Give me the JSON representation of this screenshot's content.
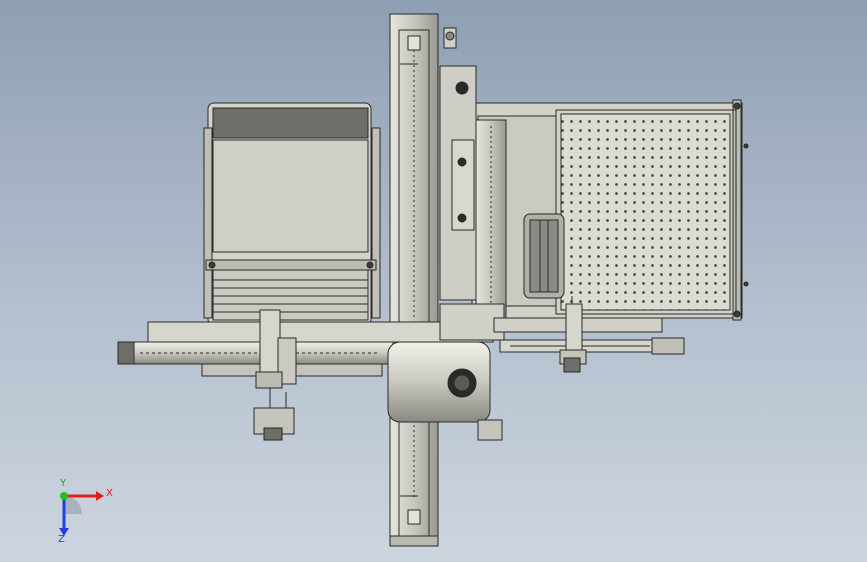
{
  "viewport": {
    "background_top": "#8f9fb3",
    "background_bottom": "#cdd5df"
  },
  "model": {
    "fill_light": "#d8d8d0",
    "fill_mid": "#c4c4bc",
    "fill_dark": "#6e6e68",
    "edge": "#2a2a28"
  },
  "triad": {
    "x_label": "X",
    "y_label": "Y",
    "z_label": "Z",
    "x_color": "#e02020",
    "y_color": "#20c020",
    "z_color": "#2040e0"
  }
}
